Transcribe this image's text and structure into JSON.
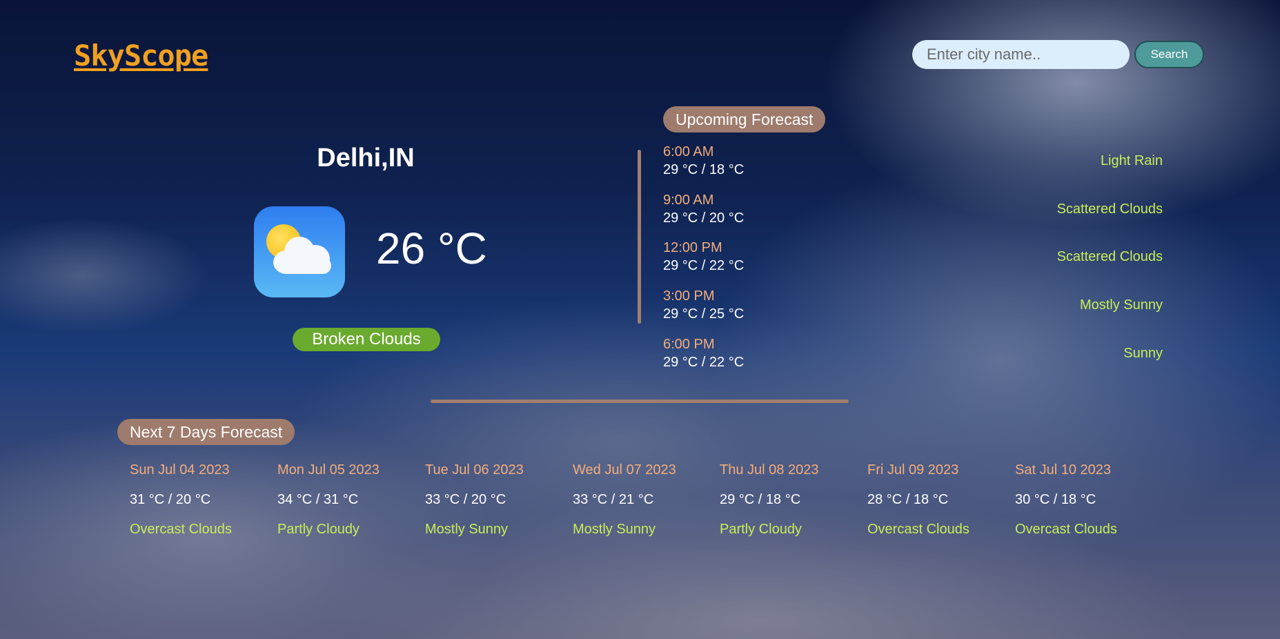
{
  "app": {
    "logo": "SkyScope"
  },
  "search": {
    "placeholder": "Enter city name..",
    "value": "",
    "button_label": "Search"
  },
  "current": {
    "city": "Delhi,IN",
    "temperature": "26 °C",
    "condition": "Broken Clouds",
    "icon": "partly-cloudy-icon"
  },
  "upcoming": {
    "title": "Upcoming Forecast",
    "items": [
      {
        "time": "6:00 AM",
        "temp": "29 °C / 18 °C",
        "condition": "Light Rain"
      },
      {
        "time": "9:00 AM",
        "temp": "29 °C / 20 °C",
        "condition": "Scattered Clouds"
      },
      {
        "time": "12:00 PM",
        "temp": "29 °C / 22 °C",
        "condition": "Scattered Clouds"
      },
      {
        "time": "3:00 PM",
        "temp": "29 °C / 25 °C",
        "condition": "Mostly Sunny"
      },
      {
        "time": "6:00 PM",
        "temp": "29 °C / 22 °C",
        "condition": "Sunny"
      }
    ]
  },
  "week": {
    "title": "Next 7 Days Forecast",
    "days": [
      {
        "date": "Sun Jul 04 2023",
        "temp": "31 °C / 20 °C",
        "condition": "Overcast Clouds"
      },
      {
        "date": "Mon Jul 05 2023",
        "temp": "34 °C / 31 °C",
        "condition": "Partly Cloudy"
      },
      {
        "date": "Tue Jul 06 2023",
        "temp": "33 °C / 20 °C",
        "condition": "Mostly Sunny"
      },
      {
        "date": "Wed Jul 07 2023",
        "temp": "33 °C / 21 °C",
        "condition": "Mostly Sunny"
      },
      {
        "date": "Thu Jul 08 2023",
        "temp": "29 °C / 18 °C",
        "condition": "Partly Cloudy"
      },
      {
        "date": "Fri Jul 09 2023",
        "temp": "28 °C / 18 °C",
        "condition": "Overcast Clouds"
      },
      {
        "date": "Sat Jul 10 2023",
        "temp": "30 °C / 18 °C",
        "condition": "Overcast Clouds"
      }
    ]
  },
  "colors": {
    "logo": "#f0a020",
    "time_text": "#f3ad7a",
    "condition_text": "#c8ee58",
    "pill_bg": "#9e7b6c",
    "badge_bg": "#6aaa2e",
    "search_button_bg": "#4f9a9a"
  }
}
